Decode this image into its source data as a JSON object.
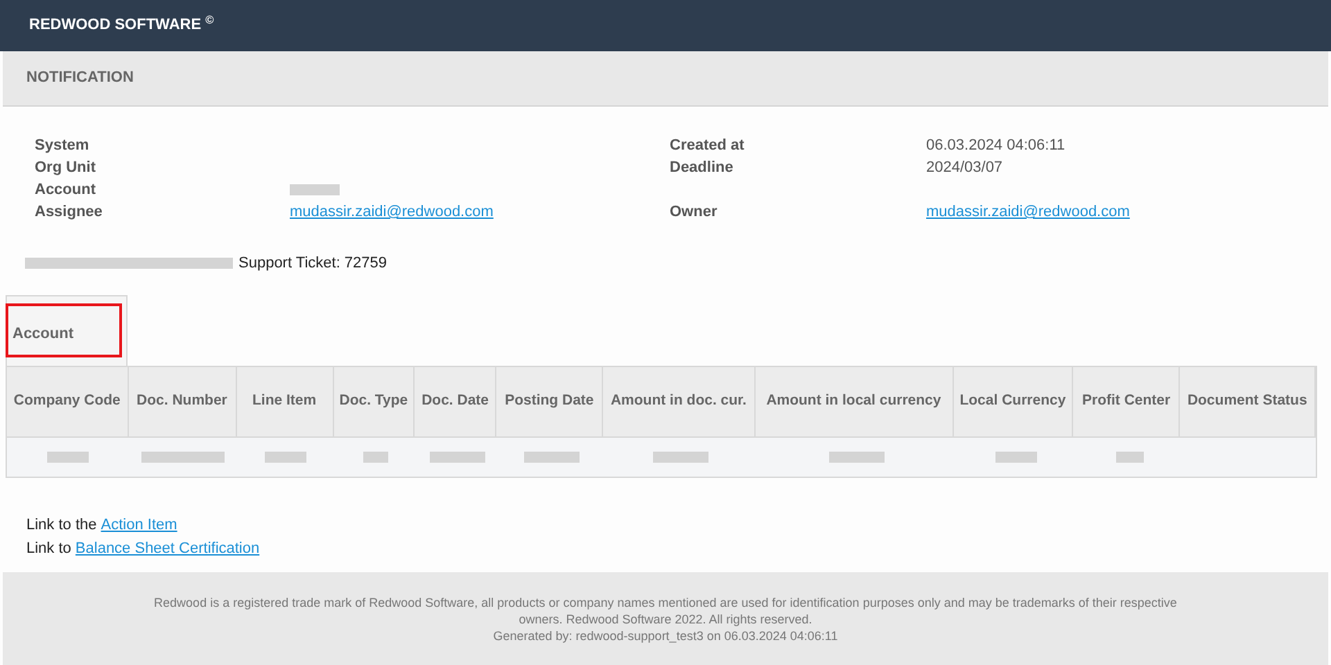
{
  "header": {
    "title": "REDWOOD SOFTWARE $^{©}$"
  },
  "section": {
    "title": "NOTIFICATION"
  },
  "details_left": [
    {
      "label": "System",
      "kind": "empty"
    },
    {
      "label": "Org Unit",
      "kind": "empty"
    },
    {
      "label": "Account",
      "kind": "redacted"
    },
    {
      "label": "Assignee",
      "kind": "link",
      "value": "mudassir.zaidi@redwood.com"
    }
  ],
  "details_right": [
    {
      "label": "Created at",
      "kind": "text",
      "value": "06.03.2024 04:06:11"
    },
    {
      "label": "Deadline",
      "kind": "text",
      "value": "2024/03/07"
    },
    {
      "kind": "empty"
    },
    {
      "label": "Owner",
      "kind": "link",
      "value": "mudassir.zaidi@redwood.com"
    }
  ],
  "ticket": {
    "prefix_redacted": true,
    "text": "Support Ticket: 72759"
  },
  "group_tab": {
    "label": "Account",
    "highlighted": true
  },
  "table": {
    "columns": [
      "Company Code",
      "Doc. Number",
      "Line Item",
      "Doc. Type",
      "Doc. Date",
      "Posting Date",
      "Amount in doc. cur.",
      "Amount in local currency",
      "Local Currency",
      "Profit Center",
      "Document Status"
    ],
    "rows": [
      {
        "cells": [
          {
            "redacted": true
          },
          {
            "redacted": true
          },
          {
            "redacted": true
          },
          {
            "redacted": true
          },
          {
            "redacted": true
          },
          {
            "redacted": true
          },
          {
            "redacted": true
          },
          {
            "redacted": true
          },
          {
            "redacted": true
          },
          {
            "redacted": true
          }
        ]
      }
    ]
  },
  "links": [
    {
      "prefix": "Link to the",
      "link": "Action Item"
    },
    {
      "prefix": "Link to",
      "link": "Balance Sheet Certification"
    }
  ],
  "footer": {
    "notice": "Redwood is a registered trade mark of Redwood Software, all products or company names mentioned are used for identification purposes only and may be trademarks of their respective owners. Redwood Software 2022. All rights reserved.",
    "generated": "Generated by: redwood-support_test3 on 06.03.2024 04:06:11"
  }
}
